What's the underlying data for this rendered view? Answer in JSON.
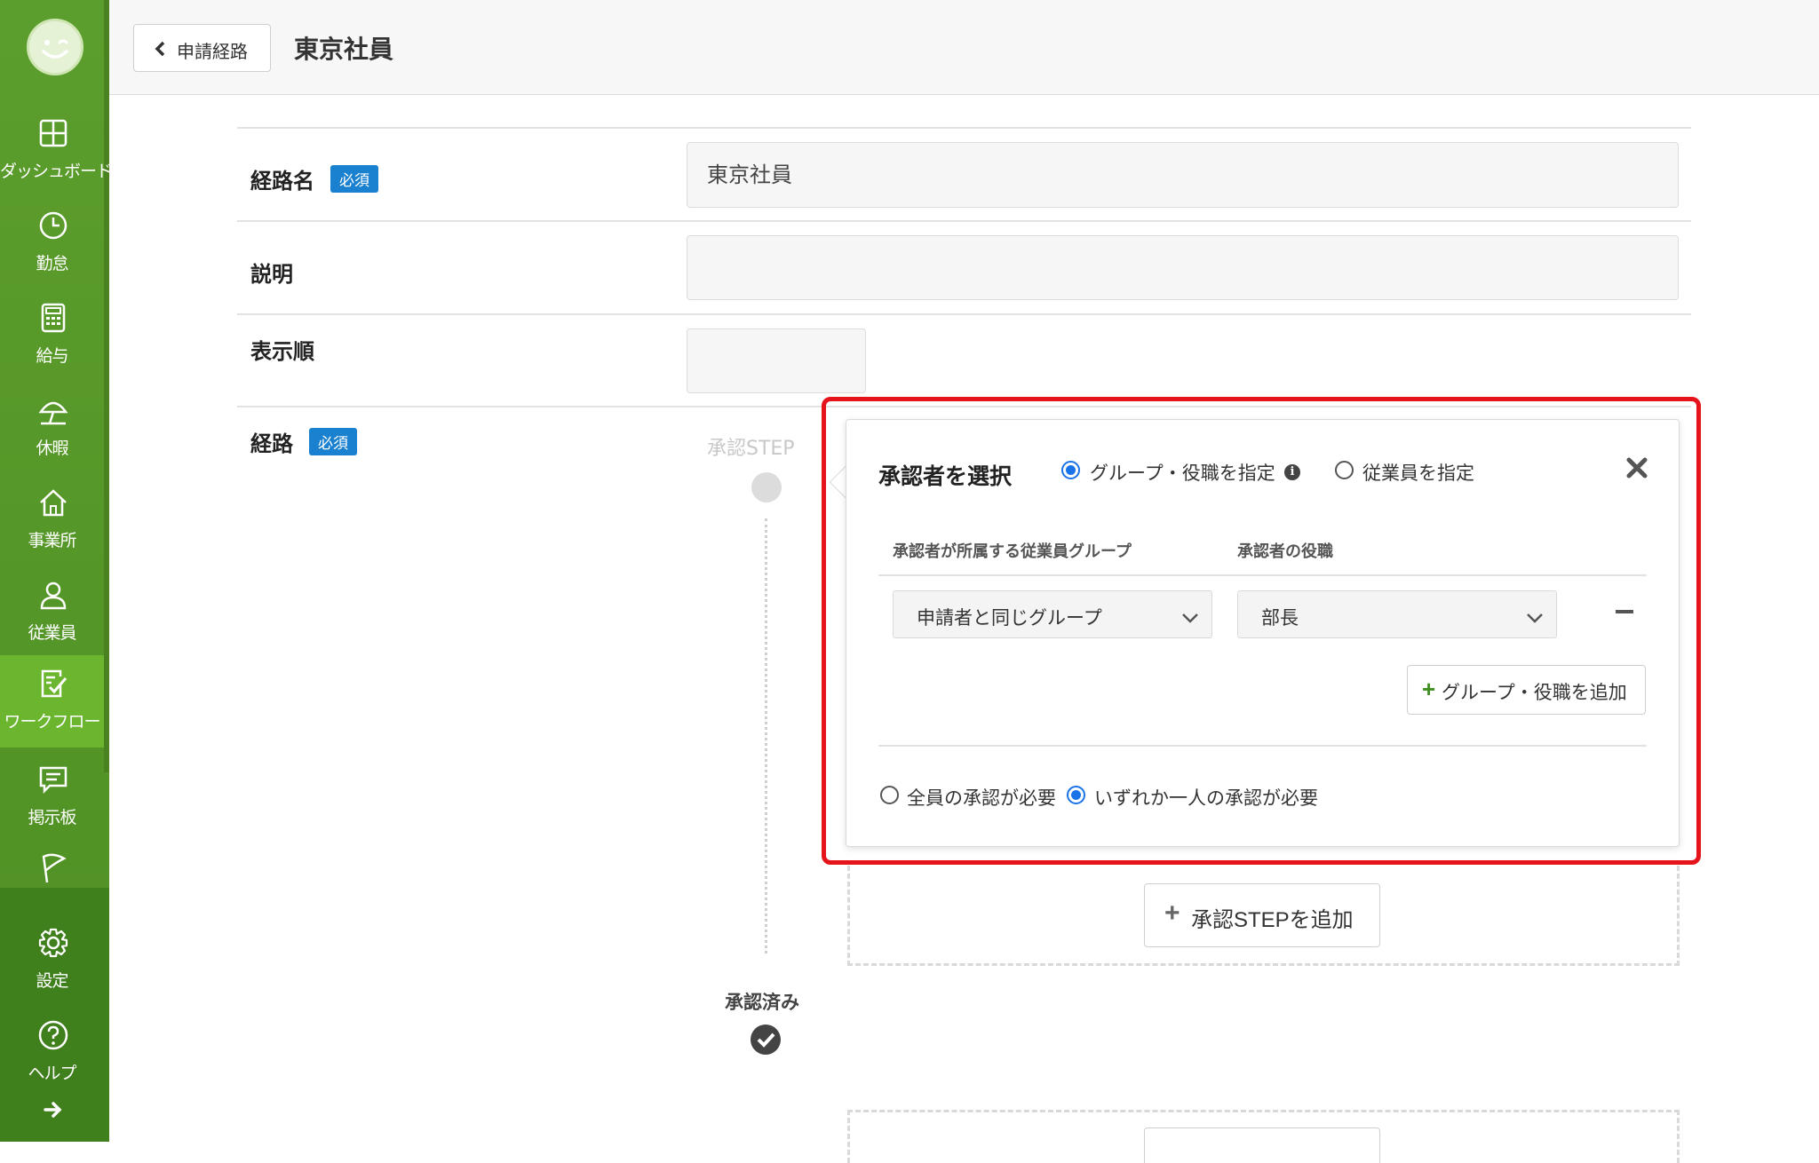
{
  "header": {
    "back_label": "申請経路",
    "title": "東京社員"
  },
  "sidebar": {
    "items": [
      {
        "label": "ダッシュボード",
        "icon": "dashboard-icon"
      },
      {
        "label": "勤怠",
        "icon": "clock-icon"
      },
      {
        "label": "給与",
        "icon": "calculator-icon"
      },
      {
        "label": "休暇",
        "icon": "umbrella-icon"
      },
      {
        "label": "事業所",
        "icon": "home-icon"
      },
      {
        "label": "従業員",
        "icon": "person-icon"
      },
      {
        "label": "ワークフロー",
        "icon": "workflow-icon"
      },
      {
        "label": "掲示板",
        "icon": "chat-icon"
      },
      {
        "label": "",
        "icon": "flag-icon"
      },
      {
        "label": "設定",
        "icon": "gear-icon"
      },
      {
        "label": "ヘルプ",
        "icon": "help-icon"
      }
    ],
    "active": "ワークフロー",
    "expand_icon": "arrow-right-icon"
  },
  "form": {
    "route_name_label": "経路名",
    "route_name_value": "東京社員",
    "description_label": "説明",
    "description_value": "",
    "order_label": "表示順",
    "order_value": "",
    "route_label": "経路",
    "required_badge": "必須"
  },
  "route": {
    "step_label": "承認STEP",
    "approved_label": "承認済み",
    "add_step_label": "承認STEPを追加"
  },
  "popover": {
    "title": "承認者を選択",
    "option_group_role": "グループ・役職を指定",
    "option_employee": "従業員を指定",
    "selected_option": "グループ・役職を指定",
    "col_group": "承認者が所属する従業員グループ",
    "col_role": "承認者の役職",
    "group_value": "申請者と同じグループ",
    "role_value": "部長",
    "add_group_label": "グループ・役職を追加",
    "approval_all": "全員の承認が必要",
    "approval_any": "いずれか一人の承認が必要",
    "selected_approval": "いずれか一人の承認が必要"
  },
  "colors": {
    "sidebar": "#5c9e2d",
    "sidebar_active": "#6bb52f",
    "required_badge": "#1a80d0",
    "highlight": "#e5141b",
    "radio_selected": "#1a73e8"
  }
}
